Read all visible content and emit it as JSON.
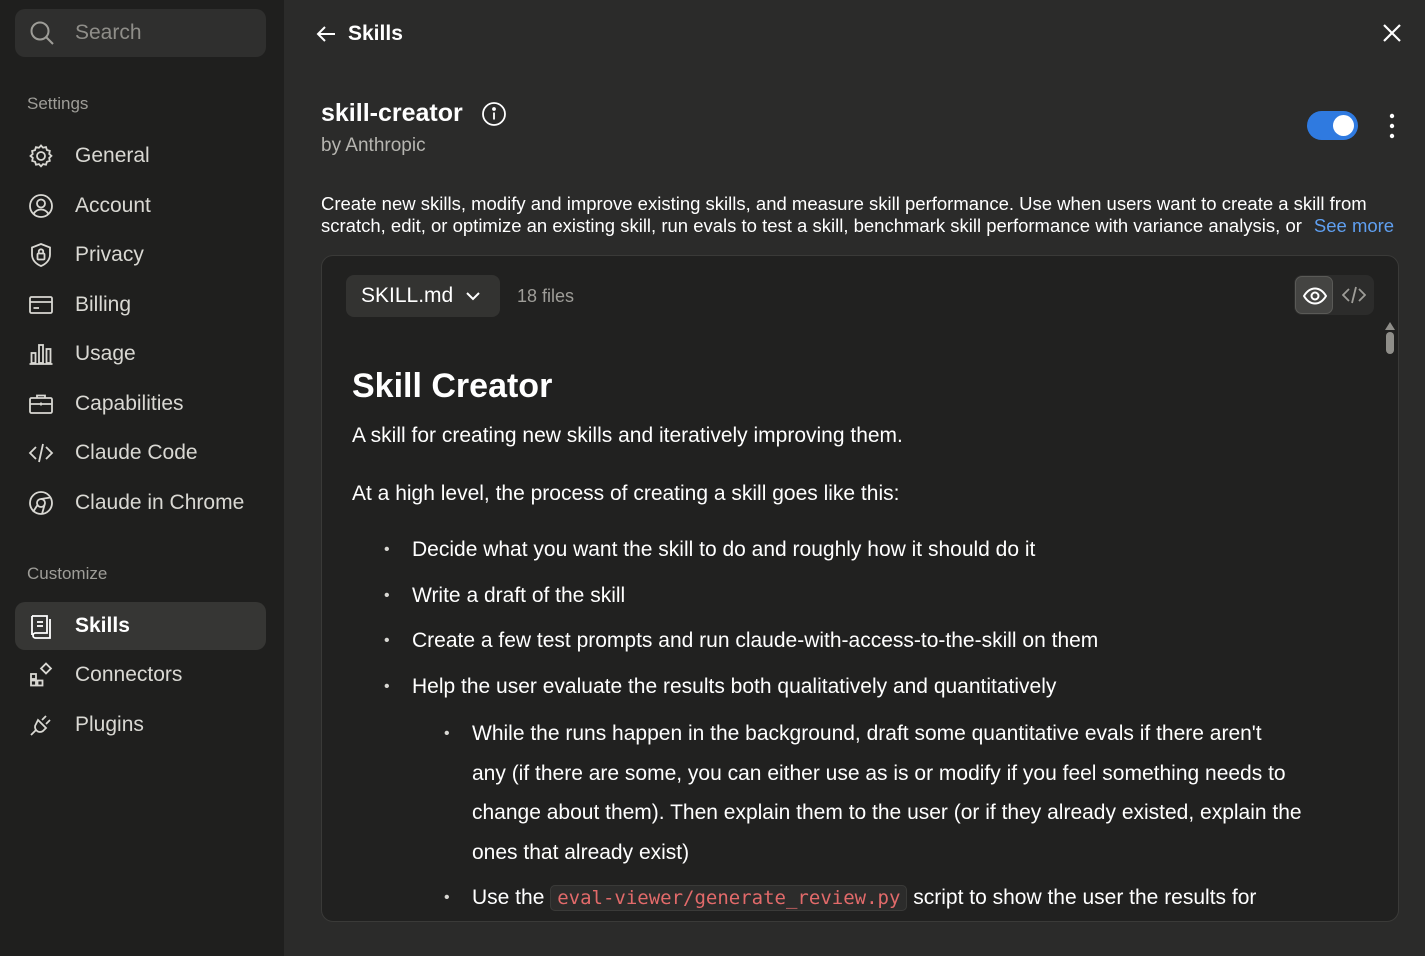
{
  "sidebar": {
    "search_placeholder": "Search",
    "settings_label": "Settings",
    "customize_label": "Customize",
    "settings_items": [
      {
        "label": "General",
        "icon": "gear-icon"
      },
      {
        "label": "Account",
        "icon": "user-circle-icon"
      },
      {
        "label": "Privacy",
        "icon": "shield-lock-icon"
      },
      {
        "label": "Billing",
        "icon": "credit-card-icon"
      },
      {
        "label": "Usage",
        "icon": "bar-chart-icon"
      },
      {
        "label": "Capabilities",
        "icon": "briefcase-icon"
      },
      {
        "label": "Claude Code",
        "icon": "code-icon"
      },
      {
        "label": "Claude in Chrome",
        "icon": "chrome-icon"
      }
    ],
    "customize_items": [
      {
        "label": "Skills",
        "icon": "skills-icon",
        "active": true
      },
      {
        "label": "Connectors",
        "icon": "connectors-icon"
      },
      {
        "label": "Plugins",
        "icon": "plug-icon"
      }
    ]
  },
  "header": {
    "back_label": "Skills"
  },
  "skill": {
    "name": "skill-creator",
    "author": "by Anthropic",
    "enabled": true,
    "description_line1": "Create new skills, modify and improve existing skills, and measure skill performance. Use when users want to create a skill from",
    "description_line2": "scratch, edit, or optimize an existing skill, run evals to test a skill, benchmark skill performance with variance analysis, or",
    "see_more": "See more"
  },
  "viewer": {
    "file_name": "SKILL.md",
    "file_count": "18 files",
    "doc": {
      "title": "Skill Creator",
      "intro": "A skill for creating new skills and iteratively improving them.",
      "process_intro": "At a high level, the process of creating a skill goes like this:",
      "bullets": [
        "Decide what you want the skill to do and roughly how it should do it",
        "Write a draft of the skill",
        "Create a few test prompts and run claude-with-access-to-the-skill on them",
        "Help the user evaluate the results both qualitatively and quantitatively"
      ],
      "sub_bullets_1": [
        "While the runs happen in the background, draft some quantitative evals if there aren't",
        "any (if there are some, you can either use as is or modify if you feel something needs to",
        "change about them). Then explain them to the user (or if they already existed, explain the",
        "ones that already exist)"
      ],
      "sub_bullet_2_prefix": "Use the",
      "sub_bullet_2_code": "eval-viewer/generate_review.py",
      "sub_bullet_2_suffix": "script to show the user the results for"
    }
  },
  "colors": {
    "accent": "#2f7ae0",
    "link": "#5f9ff0",
    "code": "#e26a6a"
  }
}
